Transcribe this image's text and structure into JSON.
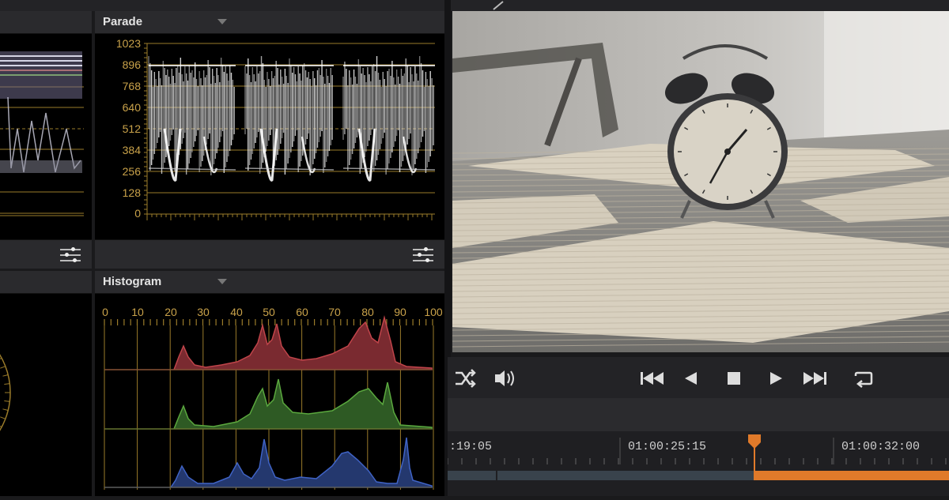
{
  "parade": {
    "title": "Parade",
    "scale": [
      "1023",
      "896",
      "768",
      "640",
      "512",
      "384",
      "256",
      "128",
      "0"
    ]
  },
  "histogram": {
    "title": "Histogram",
    "scale": [
      "0",
      "10",
      "20",
      "30",
      "40",
      "50",
      "60",
      "70",
      "80",
      "90",
      "100"
    ]
  },
  "transport": {
    "shuffle_icon": "shuffle-icon",
    "volume_icon": "volume-icon",
    "first_icon": "skip-to-start-icon",
    "prev_icon": "step-back-icon",
    "stop_icon": "stop-icon",
    "play_icon": "play-icon",
    "last_icon": "skip-to-end-icon",
    "loop_icon": "loop-icon"
  },
  "timeline": {
    "tc_left": ":19:05",
    "tc_mid": "01:00:25:15",
    "tc_right": "01:00:32:00",
    "playhead_color": "#e07a2a"
  },
  "colors": {
    "grid": "#9a7b2a",
    "red": "#c0444a",
    "green": "#5aa83e",
    "blue": "#3f63c6"
  }
}
